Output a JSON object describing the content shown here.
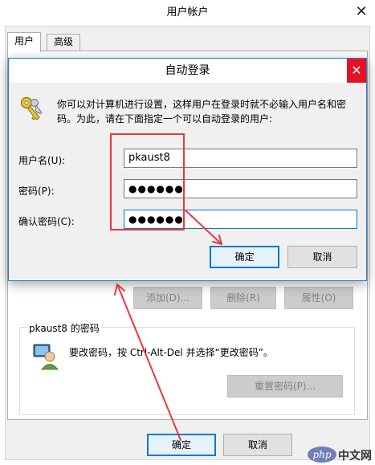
{
  "bg_window": {
    "title": "用户帐户",
    "close_glyph": "✕",
    "tabs": [
      {
        "label": "用户"
      },
      {
        "label": "高级"
      }
    ],
    "buttons": {
      "add": "添加(D)...",
      "remove": "删除(R)",
      "properties": "属性(O)"
    },
    "password_group": {
      "title": "pkaust8 的密码",
      "description": "要改密码，按 Ctrl-Alt-Del 并选择“更改密码”。",
      "reset_button": "重置密码(P)..."
    },
    "ok": "确定",
    "cancel": "取消"
  },
  "dialog": {
    "title": "自动登录",
    "close_glyph": "✕",
    "intro": "你可以对计算机进行设置，这样用户在登录时就不必输入用户名和密码。为此，请在下面指定一个可以自动登录的用户:",
    "fields": {
      "username": {
        "label": "用户名(U):",
        "value": "pkaust8"
      },
      "password": {
        "label": "密码(P):",
        "value": "●●●●●●"
      },
      "confirm": {
        "label": "确认密码(C):",
        "value": "●●●●●●"
      }
    },
    "ok": "确定",
    "cancel": "取消"
  },
  "annotation_color": "#e8383d",
  "accent_color": "#0078d7",
  "icons": [
    "key-icon",
    "users-icon",
    "close-icon"
  ],
  "watermark": {
    "logo": "php",
    "text": "中文网"
  }
}
